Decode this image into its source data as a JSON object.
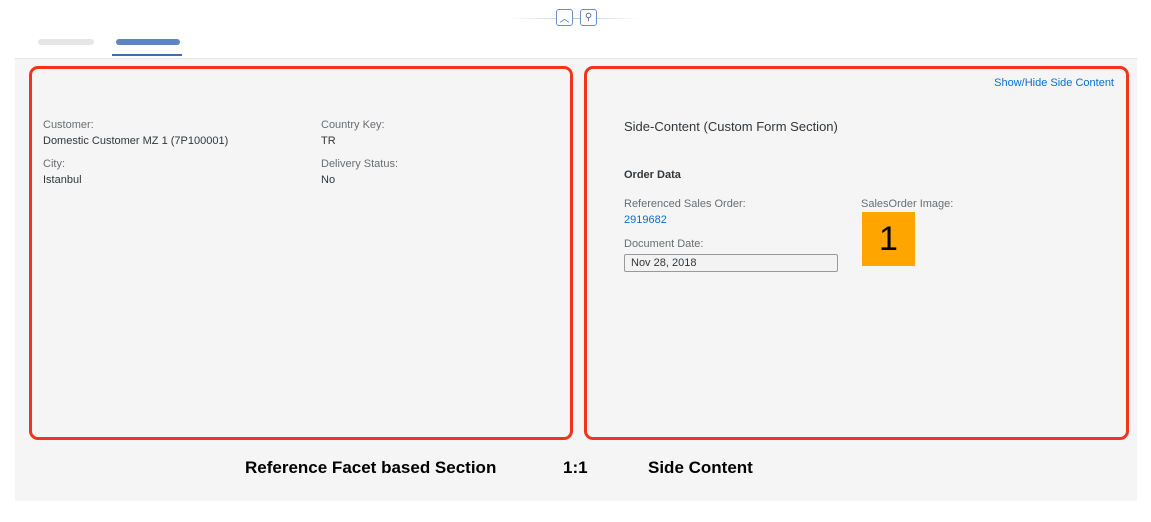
{
  "header": {
    "collapse_icon": "chevron-up-icon",
    "pin_icon": "pin-icon"
  },
  "tabs": [
    {
      "label": "",
      "selected": false
    },
    {
      "label": "",
      "selected": true
    }
  ],
  "left": {
    "fields": [
      {
        "label": "Customer:",
        "value": "Domestic Customer MZ 1 (7P100001)"
      },
      {
        "label": "Country Key:",
        "value": "TR"
      },
      {
        "label": "City:",
        "value": "Istanbul"
      },
      {
        "label": "Delivery Status:",
        "value": "No"
      }
    ]
  },
  "right": {
    "toggle_link": "Show/Hide Side Content",
    "title": "Side-Content (Custom Form Section)",
    "group": "Order Data",
    "ref_label": "Referenced Sales Order:",
    "ref_value": "2919682",
    "date_label": "Document Date:",
    "date_value": "Nov 28, 2018",
    "image_label": "SalesOrder Image:",
    "image_text": "1",
    "image_color": "#ffa500"
  },
  "captions": {
    "left": "Reference Facet based Section",
    "ratio": "1:1",
    "right": "Side Content"
  },
  "colors": {
    "highlight": "#f2341c",
    "link": "#0a6ed1"
  }
}
